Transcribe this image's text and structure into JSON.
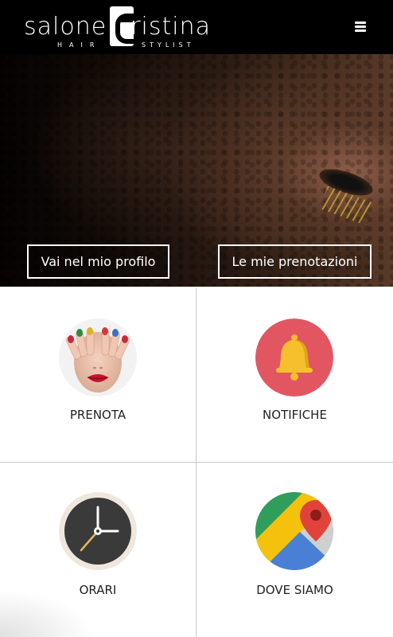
{
  "header": {
    "logo_text_left": "salone",
    "logo_text_right": "ristina",
    "logo_sub_left": "HAIR",
    "logo_sub_right": "STYLIST",
    "menu_icon": "hamburger-menu-icon"
  },
  "hero": {
    "profile_button": "Vai nel mio profilo",
    "bookings_button": "Le mie prenotazioni"
  },
  "tiles": [
    {
      "label": "PRENOTA",
      "icon": "painted-nails-photo-icon"
    },
    {
      "label": "NOTIFICHE",
      "icon": "bell-icon",
      "color": "#e25662"
    },
    {
      "label": "ORARI",
      "icon": "clock-icon"
    },
    {
      "label": "DOVE SIAMO",
      "icon": "map-pin-icon"
    }
  ],
  "colors": {
    "header_bg": "#000000",
    "bell_bg": "#e25662",
    "bell": "#f5c02c",
    "clock_face": "#3b3a3a",
    "clock_rim": "#efe7dd"
  }
}
